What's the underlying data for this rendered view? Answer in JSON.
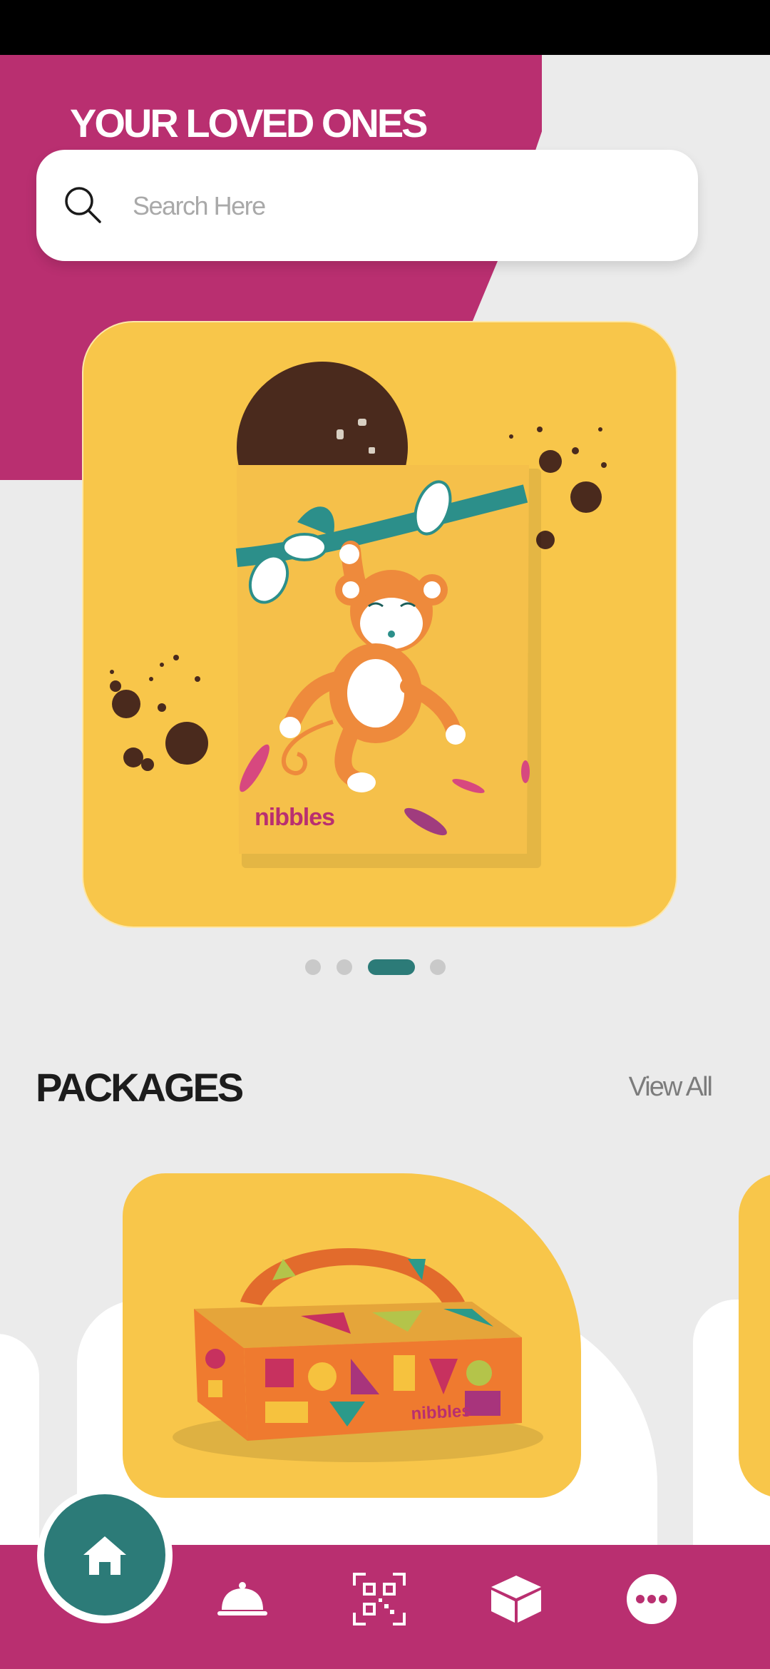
{
  "hero": {
    "title": "YOUR LOVED ONES"
  },
  "search": {
    "placeholder": "Search Here"
  },
  "carousel": {
    "brand_on_bag": "nibbles",
    "slide_count": 4,
    "active_slide_index": 2
  },
  "packages": {
    "title": "PACKAGES",
    "view_all_label": "View All",
    "box_brand": "nibbles"
  },
  "bottom_nav": {
    "items": [
      {
        "icon": "home-icon"
      },
      {
        "icon": "cloche-icon"
      },
      {
        "icon": "qr-code-icon"
      },
      {
        "icon": "box-icon"
      },
      {
        "icon": "more-icon"
      }
    ]
  },
  "colors": {
    "brand_pink": "#b92f70",
    "teal": "#2c7b78",
    "yellow": "#f8c64a",
    "background": "#ebebeb"
  }
}
